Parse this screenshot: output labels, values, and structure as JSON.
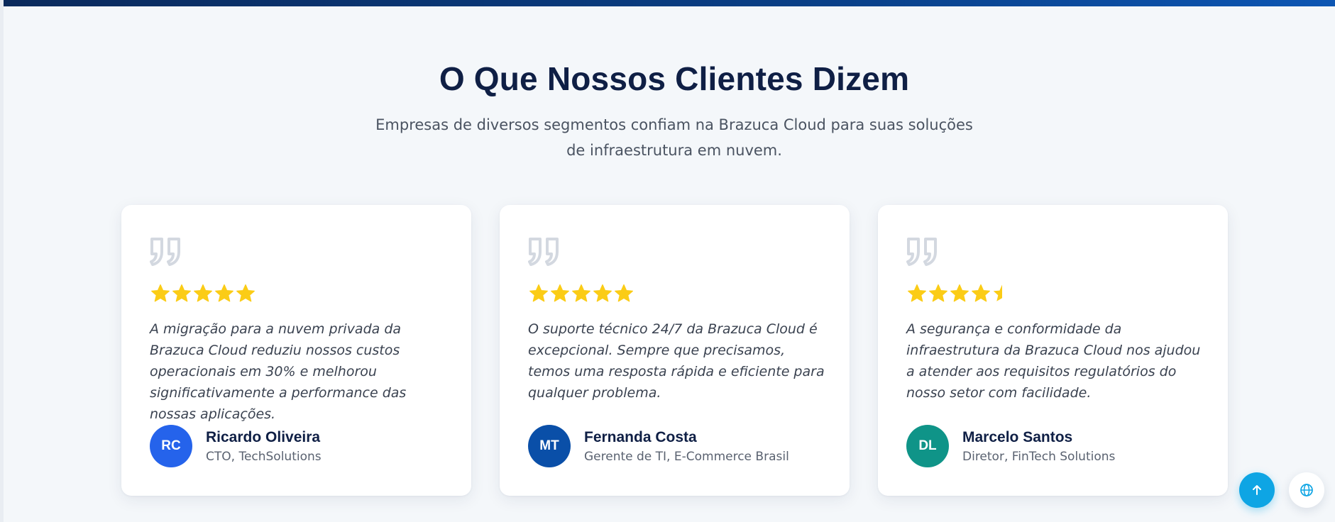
{
  "section": {
    "title": "O Que Nossos Clientes Dizem",
    "subtitle": "Empresas de diversos segmentos confiam na Brazuca Cloud para suas soluções de infraestrutura em nuvem."
  },
  "colors": {
    "star": "#fbcc16",
    "quote_icon": "#d3d8e0",
    "top_bar": "#0a3f86",
    "fab_top": "#0ea5e4",
    "fab_lang_icon": "#0ea5e4"
  },
  "testimonials": [
    {
      "quote": "A migração para a nuvem privada da Brazuca Cloud reduziu nossos custos operacionais em 30% e melhorou significativamente a performance das nossas aplicações.",
      "rating": 5,
      "initials": "RC",
      "avatar_color": "#2563eb",
      "name": "Ricardo Oliveira",
      "role": "CTO, TechSolutions"
    },
    {
      "quote": "O suporte técnico 24/7 da Brazuca Cloud é excepcional. Sempre que precisamos, temos uma resposta rápida e eficiente para qualquer problema.",
      "rating": 5,
      "initials": "MT",
      "avatar_color": "#0a4fa8",
      "name": "Fernanda Costa",
      "role": "Gerente de TI, E-Commerce Brasil"
    },
    {
      "quote": "A segurança e conformidade da infraestrutura da Brazuca Cloud nos ajudou a atender aos requisitos regulatórios do nosso setor com facilidade.",
      "rating": 4.5,
      "initials": "DL",
      "avatar_color": "#0f9488",
      "name": "Marcelo Santos",
      "role": "Diretor, FinTech Solutions"
    }
  ],
  "floating": {
    "scroll_top_icon": "arrow-up-icon",
    "language_icon": "globe-icon"
  }
}
